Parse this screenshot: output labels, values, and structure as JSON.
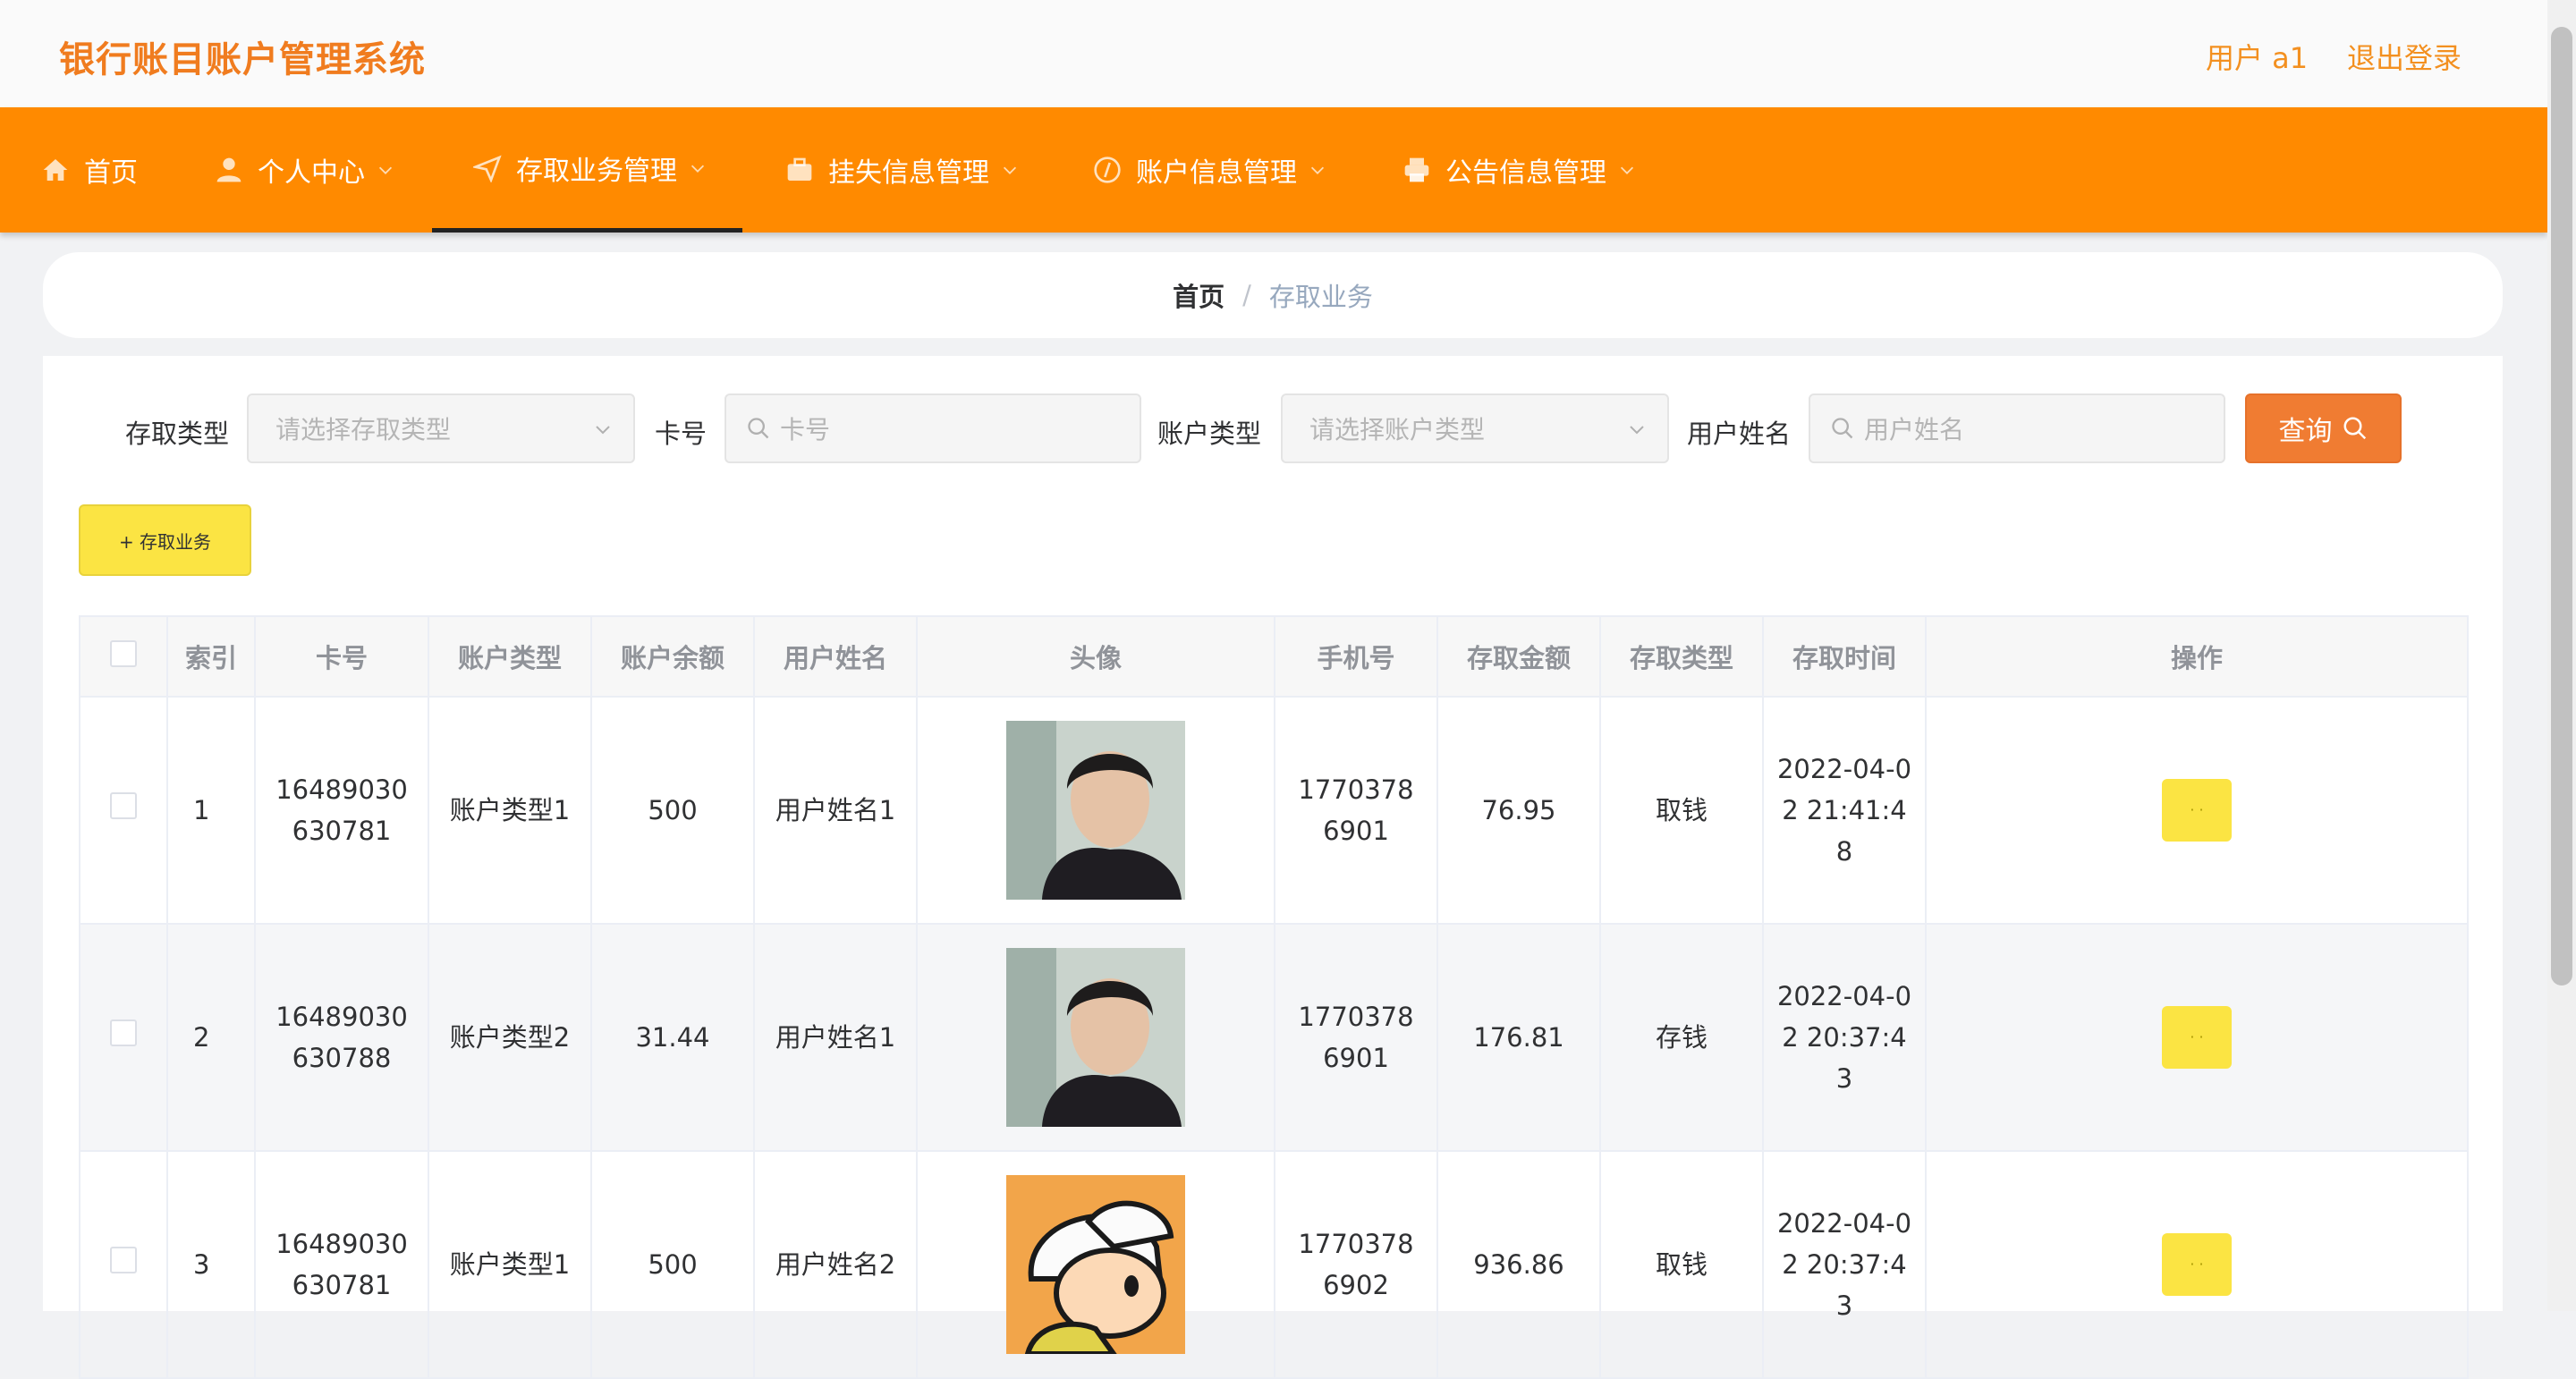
{
  "header": {
    "title": "银行账目账户管理系统",
    "user": "用户 a1",
    "logout": "退出登录"
  },
  "nav": [
    {
      "label": "首页",
      "icon": "home-icon"
    },
    {
      "label": "个人中心",
      "icon": "user-icon"
    },
    {
      "label": "存取业务管理",
      "icon": "send-icon"
    },
    {
      "label": "挂失信息管理",
      "icon": "briefcase-icon"
    },
    {
      "label": "账户信息管理",
      "icon": "compass-icon"
    },
    {
      "label": "公告信息管理",
      "icon": "printer-icon"
    }
  ],
  "breadcrumb": {
    "home": "首页",
    "separator": "/",
    "current": "存取业务"
  },
  "filters": {
    "type_label": "存取类型",
    "type_placeholder": "请选择存取类型",
    "card_label": "卡号",
    "card_placeholder": "卡号",
    "account_label": "账户类型",
    "account_placeholder": "请选择账户类型",
    "name_label": "用户姓名",
    "name_placeholder": "用户姓名",
    "query_label": "查询"
  },
  "add_button": "+ 存取业务",
  "table": {
    "headers": [
      "索引",
      "卡号",
      "账户类型",
      "账户余额",
      "用户姓名",
      "头像",
      "手机号",
      "存取金额",
      "存取类型",
      "存取时间",
      "操作"
    ],
    "rows": [
      {
        "index": "1",
        "card": "16489030630781",
        "account_type": "账户类型1",
        "balance": "500",
        "name": "用户姓名1",
        "phone": "17703786901",
        "amount": "76.95",
        "type": "取钱",
        "time": "2022-04-02 21:41:48",
        "op": "· ·"
      },
      {
        "index": "2",
        "card": "16489030630788",
        "account_type": "账户类型2",
        "balance": "31.44",
        "name": "用户姓名1",
        "phone": "17703786901",
        "amount": "176.81",
        "type": "存钱",
        "time": "2022-04-02 20:37:43",
        "op": "· ·"
      },
      {
        "index": "3",
        "card": "16489030630781",
        "account_type": "账户类型1",
        "balance": "500",
        "name": "用户姓名2",
        "phone": "17703786902",
        "amount": "936.86",
        "type": "取钱",
        "time": "2022-04-02 20:37:43",
        "op": "· ·"
      }
    ]
  },
  "colors": {
    "accent": "#ff8a00",
    "query": "#f07c32",
    "yellow": "#fbe443"
  }
}
